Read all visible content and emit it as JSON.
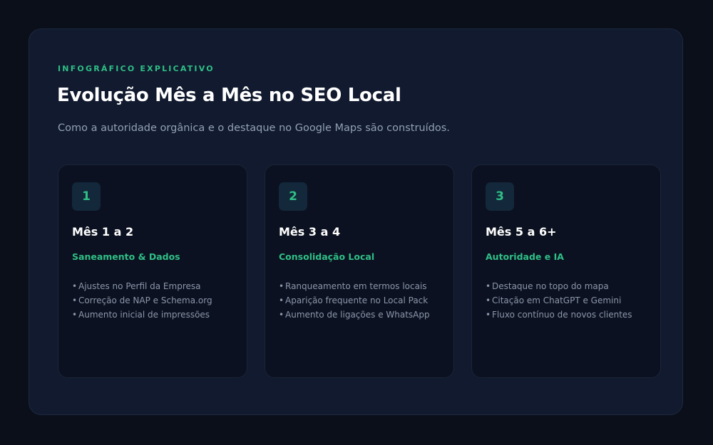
{
  "header": {
    "eyebrow": "INFOGRÁFICO EXPLICATIVO",
    "title": "Evolução Mês a Mês no SEO Local",
    "subtitle": "Como a autoridade orgânica e o destaque no Google Maps são construídos."
  },
  "cards": [
    {
      "number": "1",
      "title": "Mês 1 a 2",
      "subtitle": "Saneamento & Dados",
      "items": [
        "Ajustes no Perfil da Empresa",
        "Correção de NAP e Schema.org",
        "Aumento inicial de impressões"
      ]
    },
    {
      "number": "2",
      "title": "Mês 3 a 4",
      "subtitle": "Consolidação Local",
      "items": [
        "Ranqueamento em termos locais",
        "Aparição frequente no Local Pack",
        "Aumento de ligações e WhatsApp"
      ]
    },
    {
      "number": "3",
      "title": "Mês 5 a 6+",
      "subtitle": "Autoridade e IA",
      "items": [
        "Destaque no topo do mapa",
        "Citação em ChatGPT e Gemini",
        "Fluxo contínuo de novos clientes"
      ]
    }
  ],
  "bullet_glyph": "•",
  "colors": {
    "background": "#0a0f1a",
    "panel": "#111a2e",
    "card": "#0b1120",
    "accent": "#2fbf86",
    "title": "#ffffff",
    "muted": "#93a0b5"
  }
}
